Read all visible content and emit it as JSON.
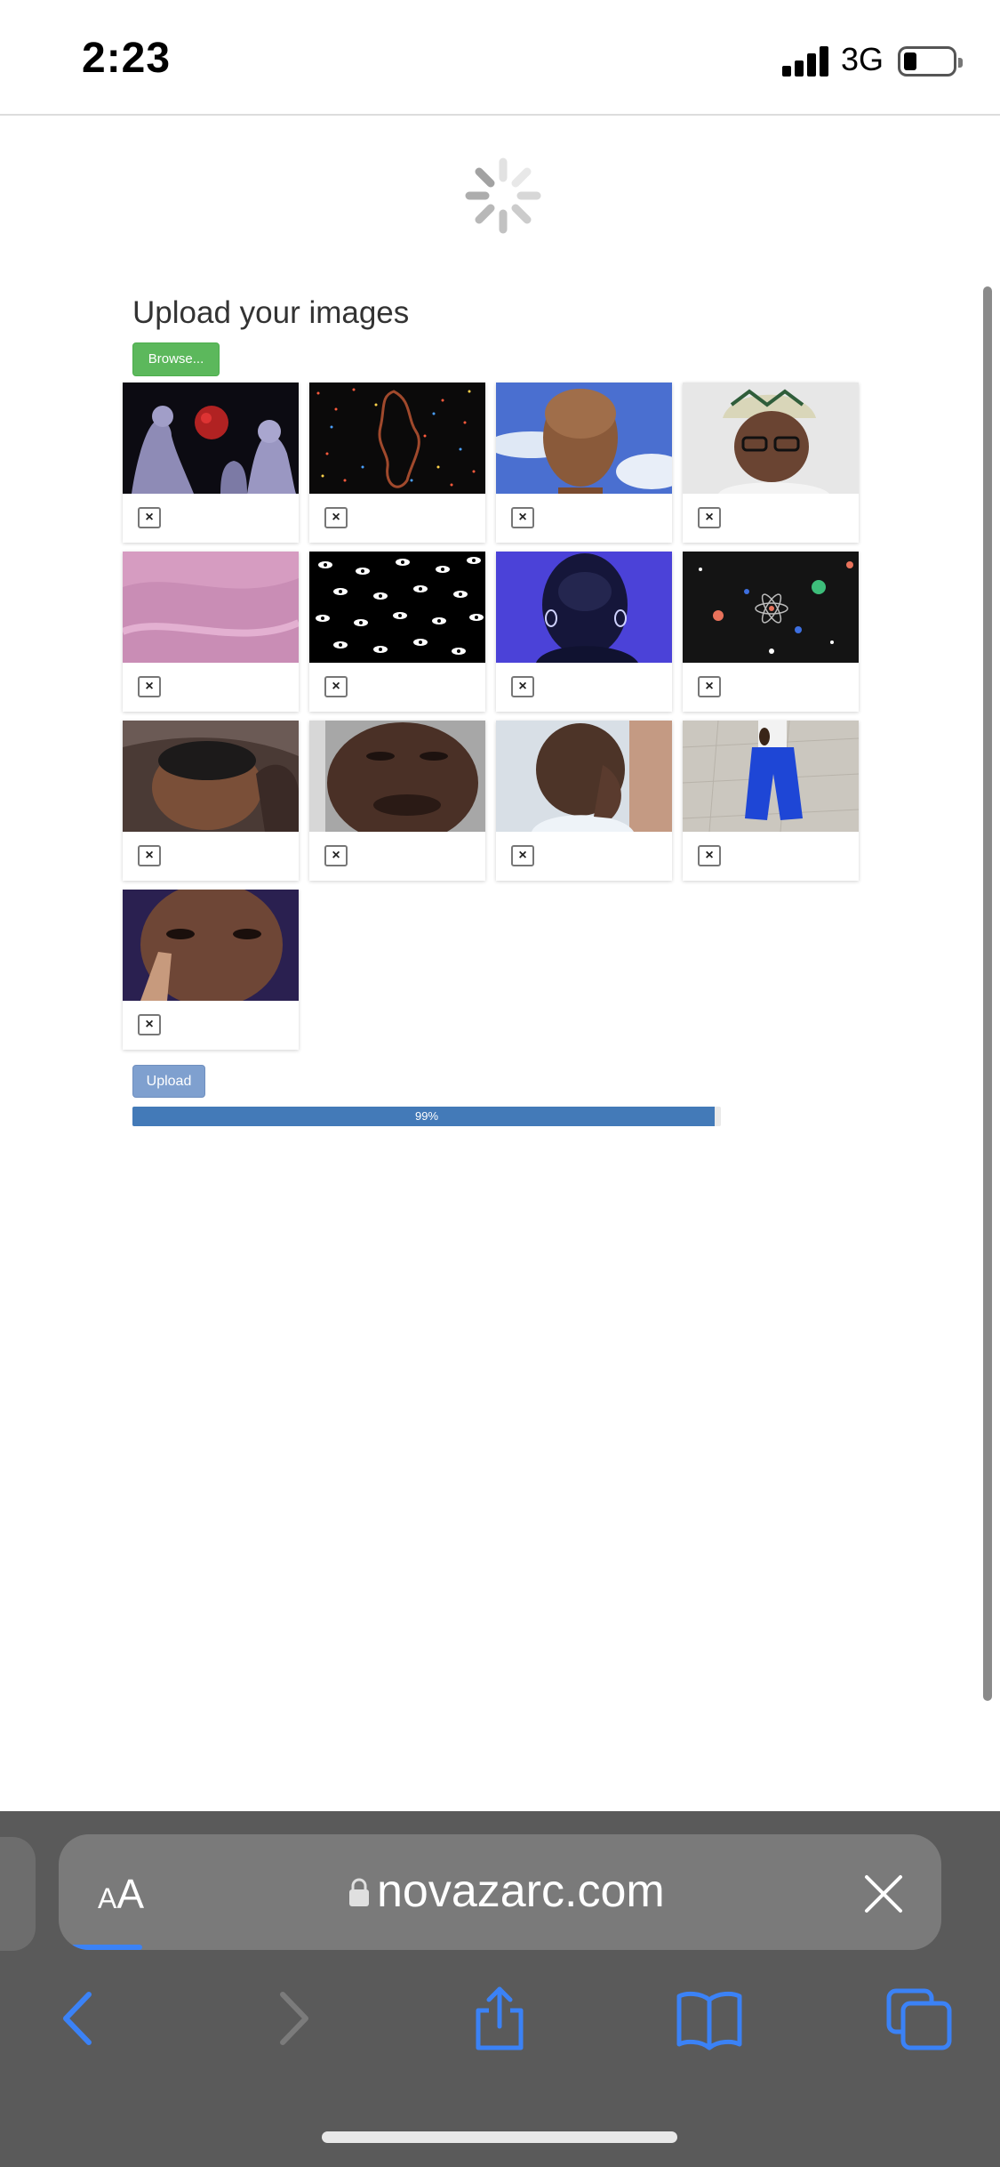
{
  "status_bar": {
    "time": "2:23",
    "network": "3G"
  },
  "page": {
    "title": "Upload your images",
    "browse_label": "Browse...",
    "upload_label": "Upload",
    "progress": {
      "value": 99,
      "label": "99%"
    },
    "remove_label": "×",
    "images": [
      "classical statues with red moon",
      "dotted red figure on dark background",
      "bald man portrait with blue sky",
      "man in glasses and embroidered cap",
      "pink fabric",
      "pattern of eyes on black",
      "dark sculpture on purple background",
      "atom icon with colorful dots",
      "young man close-up selfie",
      "face close-up selfie",
      "man resting face on hand",
      "person in blue pants on tiled floor",
      "face partially covered by hand"
    ]
  },
  "safari": {
    "text_size_label_small": "A",
    "text_size_label_large": "A",
    "url": "novazarc.com"
  },
  "colors": {
    "browse": "#5cb85c",
    "upload": "#7fa0cf",
    "progress": "#437ab8",
    "safari_toolbar": "#5a5a5a",
    "safari_icon": "#3b82f6"
  }
}
